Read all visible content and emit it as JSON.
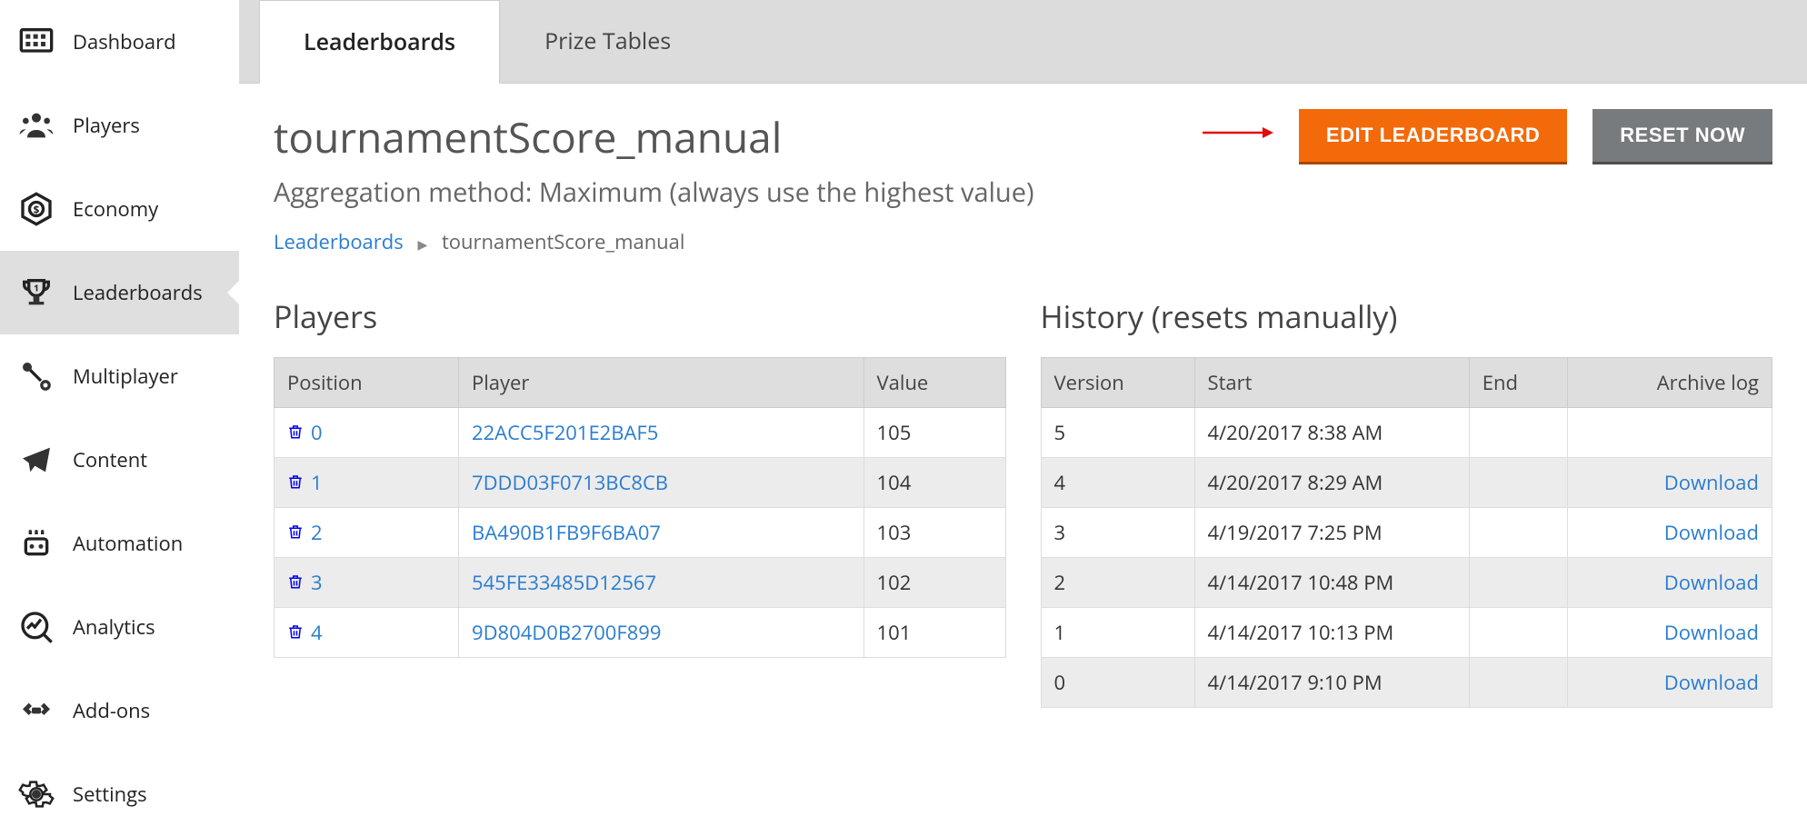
{
  "sidebar": {
    "items": [
      {
        "label": "Dashboard",
        "icon": "dashboard"
      },
      {
        "label": "Players",
        "icon": "players"
      },
      {
        "label": "Economy",
        "icon": "economy"
      },
      {
        "label": "Leaderboards",
        "icon": "leaderboards",
        "active": true
      },
      {
        "label": "Multiplayer",
        "icon": "multiplayer"
      },
      {
        "label": "Content",
        "icon": "content"
      },
      {
        "label": "Automation",
        "icon": "automation"
      },
      {
        "label": "Analytics",
        "icon": "analytics"
      },
      {
        "label": "Add-ons",
        "icon": "addons"
      },
      {
        "label": "Settings",
        "icon": "settings"
      }
    ]
  },
  "tabs": [
    {
      "label": "Leaderboards",
      "active": true
    },
    {
      "label": "Prize Tables",
      "active": false
    }
  ],
  "page": {
    "title": "tournamentScore_manual",
    "subtitle": "Aggregation method: Maximum (always use the highest value)",
    "edit_btn": "EDIT LEADERBOARD",
    "reset_btn": "RESET NOW"
  },
  "breadcrumb": {
    "root": "Leaderboards",
    "current": "tournamentScore_manual"
  },
  "players_section": {
    "heading": "Players",
    "columns": [
      "Position",
      "Player",
      "Value"
    ],
    "rows": [
      {
        "position": "0",
        "player": "22ACC5F201E2BAF5",
        "value": "105"
      },
      {
        "position": "1",
        "player": "7DDD03F0713BC8CB",
        "value": "104"
      },
      {
        "position": "2",
        "player": "BA490B1FB9F6BA07",
        "value": "103"
      },
      {
        "position": "3",
        "player": "545FE33485D12567",
        "value": "102"
      },
      {
        "position": "4",
        "player": "9D804D0B2700F899",
        "value": "101"
      }
    ]
  },
  "history_section": {
    "heading": "History (resets manually)",
    "columns": [
      "Version",
      "Start",
      "End",
      "Archive log"
    ],
    "download_label": "Download",
    "rows": [
      {
        "version": "5",
        "start": "4/20/2017 8:38 AM",
        "end": "",
        "download": false
      },
      {
        "version": "4",
        "start": "4/20/2017 8:29 AM",
        "end": "",
        "download": true
      },
      {
        "version": "3",
        "start": "4/19/2017 7:25 PM",
        "end": "",
        "download": true
      },
      {
        "version": "2",
        "start": "4/14/2017 10:48 PM",
        "end": "",
        "download": true
      },
      {
        "version": "1",
        "start": "4/14/2017 10:13 PM",
        "end": "",
        "download": true
      },
      {
        "version": "0",
        "start": "4/14/2017 9:10 PM",
        "end": "",
        "download": true
      }
    ]
  }
}
